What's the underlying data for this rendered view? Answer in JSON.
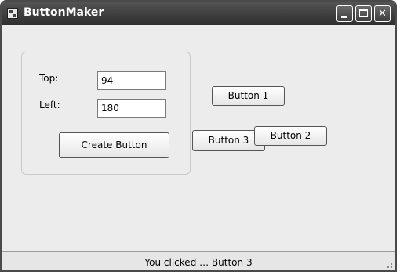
{
  "window": {
    "title": "ButtonMaker",
    "controls": {
      "minimize": "minimize",
      "maximize": "maximize",
      "close": "✕"
    }
  },
  "form": {
    "top_label": "Top:",
    "top_value": "94",
    "left_label": "Left:",
    "left_value": "180",
    "create_button": "Create Button"
  },
  "buttons": {
    "button1": "Button 1",
    "button2": "Button 2",
    "button3": "Button 3"
  },
  "status": {
    "text": "You clicked … Button 3"
  },
  "colors": {
    "titlebar": "#444444",
    "window_bg": "#ececec"
  },
  "icons": {
    "app": "app-window-icon",
    "minimize": "minimize-icon",
    "maximize": "maximize-icon",
    "close": "close-icon",
    "grip": "resize-grip-icon"
  }
}
